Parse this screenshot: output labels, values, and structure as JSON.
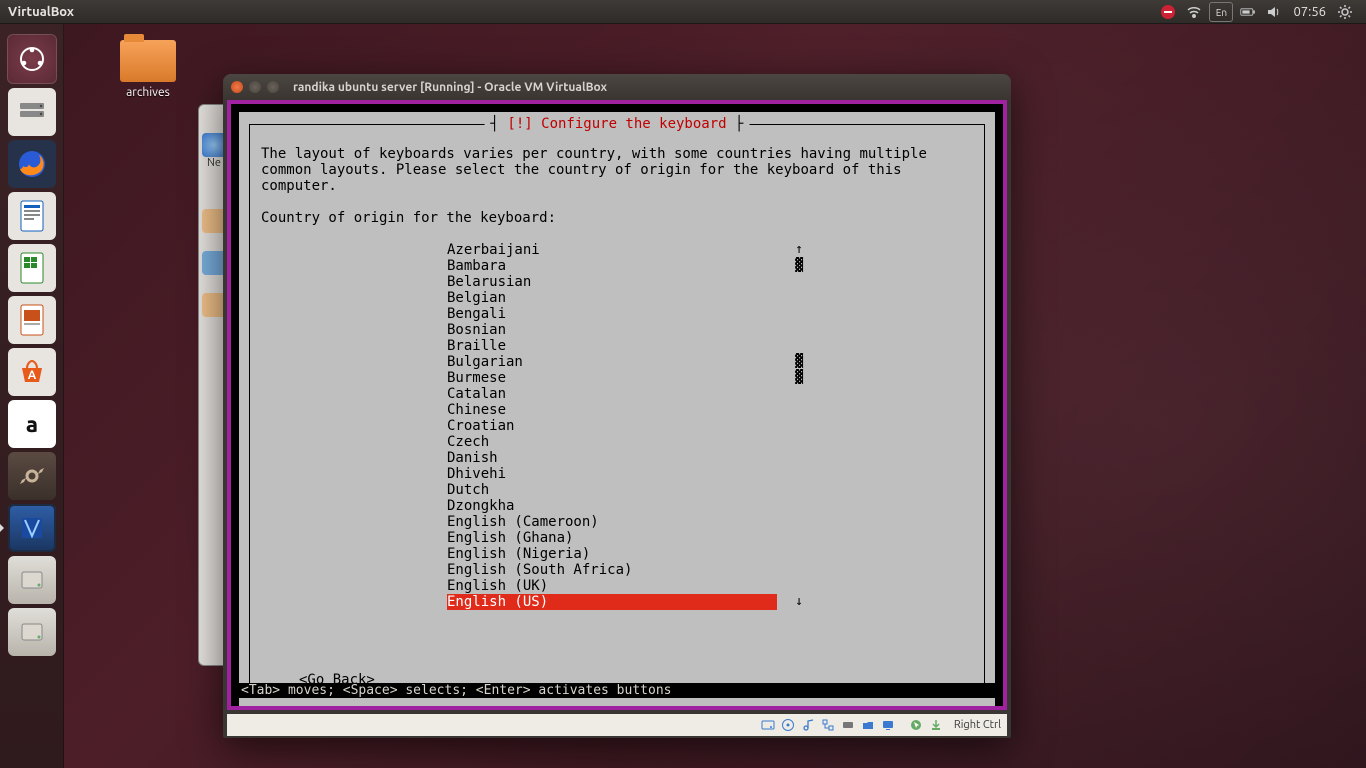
{
  "topbar": {
    "active_app": "VirtualBox",
    "lang": "En",
    "time": "07:56"
  },
  "desktop": {
    "folder_label": "archives"
  },
  "vm_window": {
    "title": "randika ubuntu server [Running] - Oracle VM VirtualBox",
    "host_key": "Right Ctrl"
  },
  "installer": {
    "title_tag": "[!]",
    "title": "Configure the keyboard",
    "description": "The layout of keyboards varies per country, with some countries having multiple common layouts. Please select the country of origin for the keyboard of this computer.",
    "prompt": "Country of origin for the keyboard:",
    "go_back": "<Go Back>",
    "selected": "English (US)",
    "items": [
      "Azerbaijani",
      "Bambara",
      "Belarusian",
      "Belgian",
      "Bengali",
      "Bosnian",
      "Braille",
      "Bulgarian",
      "Burmese",
      "Catalan",
      "Chinese",
      "Croatian",
      "Czech",
      "Danish",
      "Dhivehi",
      "Dutch",
      "Dzongkha",
      "English (Cameroon)",
      "English (Ghana)",
      "English (Nigeria)",
      "English (South Africa)",
      "English (UK)",
      "English (US)"
    ],
    "key_hint": "<Tab> moves; <Space> selects; <Enter> activates buttons"
  },
  "launcher": {
    "active": "virtualbox"
  }
}
